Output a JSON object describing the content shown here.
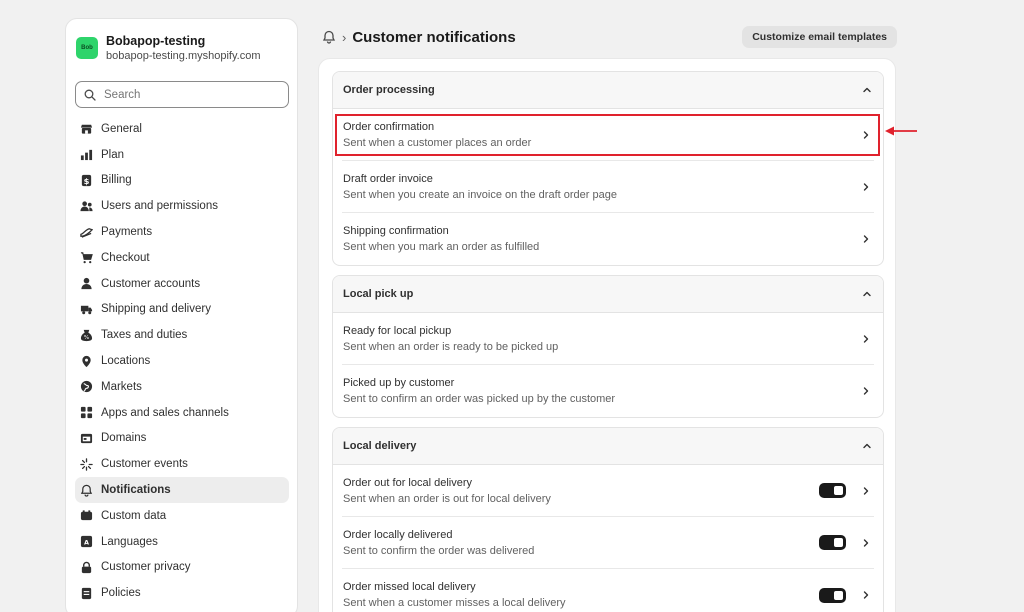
{
  "store": {
    "avatar_text": "Bob",
    "name": "Bobapop-testing",
    "url": "bobapop-testing.myshopify.com"
  },
  "search": {
    "placeholder": "Search"
  },
  "sidebar": {
    "items": [
      {
        "label": "General",
        "icon": "store-icon"
      },
      {
        "label": "Plan",
        "icon": "chart-icon"
      },
      {
        "label": "Billing",
        "icon": "dollar-icon"
      },
      {
        "label": "Users and permissions",
        "icon": "users-icon"
      },
      {
        "label": "Payments",
        "icon": "payment-icon"
      },
      {
        "label": "Checkout",
        "icon": "cart-icon"
      },
      {
        "label": "Customer accounts",
        "icon": "person-icon"
      },
      {
        "label": "Shipping and delivery",
        "icon": "truck-icon"
      },
      {
        "label": "Taxes and duties",
        "icon": "tax-icon"
      },
      {
        "label": "Locations",
        "icon": "pin-icon"
      },
      {
        "label": "Markets",
        "icon": "globe-icon"
      },
      {
        "label": "Apps and sales channels",
        "icon": "apps-icon"
      },
      {
        "label": "Domains",
        "icon": "domain-icon"
      },
      {
        "label": "Customer events",
        "icon": "sparkle-icon"
      },
      {
        "label": "Notifications",
        "icon": "bell-icon",
        "active": true
      },
      {
        "label": "Custom data",
        "icon": "data-icon"
      },
      {
        "label": "Languages",
        "icon": "language-icon"
      },
      {
        "label": "Customer privacy",
        "icon": "lock-icon"
      },
      {
        "label": "Policies",
        "icon": "policy-icon"
      }
    ]
  },
  "header": {
    "separator": "›",
    "title": "Customer notifications",
    "customize_label": "Customize email templates"
  },
  "sections": [
    {
      "title": "Order processing",
      "rows": [
        {
          "title": "Order confirmation",
          "subtitle": "Sent when a customer places an order"
        },
        {
          "title": "Draft order invoice",
          "subtitle": "Sent when you create an invoice on the draft order page"
        },
        {
          "title": "Shipping confirmation",
          "subtitle": "Sent when you mark an order as fulfilled"
        }
      ]
    },
    {
      "title": "Local pick up",
      "rows": [
        {
          "title": "Ready for local pickup",
          "subtitle": "Sent when an order is ready to be picked up"
        },
        {
          "title": "Picked up by customer",
          "subtitle": "Sent to confirm an order was picked up by the customer"
        }
      ]
    },
    {
      "title": "Local delivery",
      "rows": [
        {
          "title": "Order out for local delivery",
          "subtitle": "Sent when an order is out for local delivery",
          "toggle": true
        },
        {
          "title": "Order locally delivered",
          "subtitle": "Sent to confirm the order was delivered",
          "toggle": true
        },
        {
          "title": "Order missed local delivery",
          "subtitle": "Sent when a customer misses a local delivery",
          "toggle": true
        }
      ]
    }
  ],
  "colors": {
    "accent_highlight": "#e0222d",
    "avatar_bg": "#2ed46b",
    "toggle_on": "#1a1a1a"
  }
}
